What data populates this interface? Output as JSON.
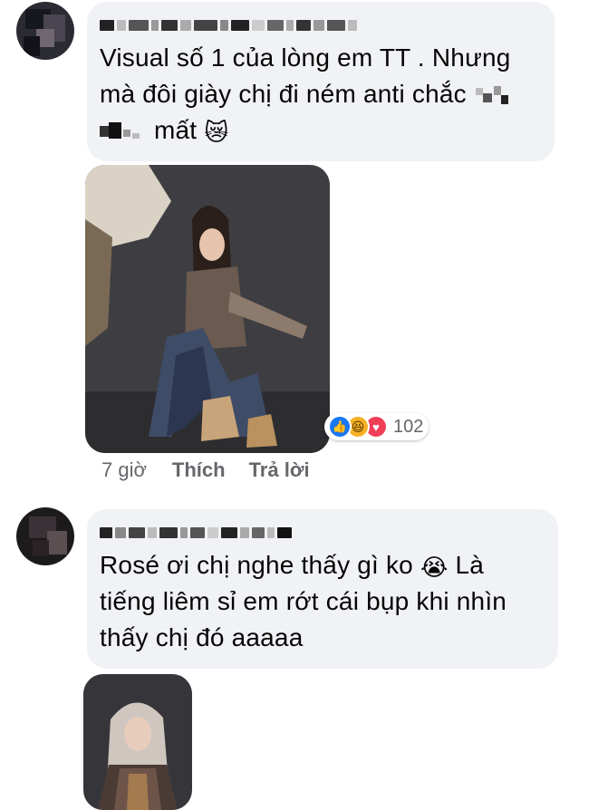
{
  "comments": [
    {
      "text_lines": [
        "Visual số 1 của lòng em TT . Nhưng",
        "mà đôi giày chị đi ném anti chắc",
        "mất"
      ],
      "emoji_end": "😿",
      "reactions": {
        "icons": [
          "like-icon",
          "haha-icon",
          "love-icon"
        ],
        "count": "102"
      },
      "time": "7 giờ",
      "like_label": "Thích",
      "reply_label": "Trả lời"
    },
    {
      "text_lines": [
        "Rosé ơi chị nghe thấy gì ko",
        "Là",
        "tiếng liêm sỉ em rớt cái bụp khi nhìn",
        "thấy chị đó aaaaa"
      ],
      "emoji_mid": "😭"
    }
  ],
  "colors": {
    "bubble": "#f0f2f5",
    "like": "#1877f2",
    "haha": "#f7b125",
    "love": "#f33e58",
    "meta": "#65676b"
  }
}
